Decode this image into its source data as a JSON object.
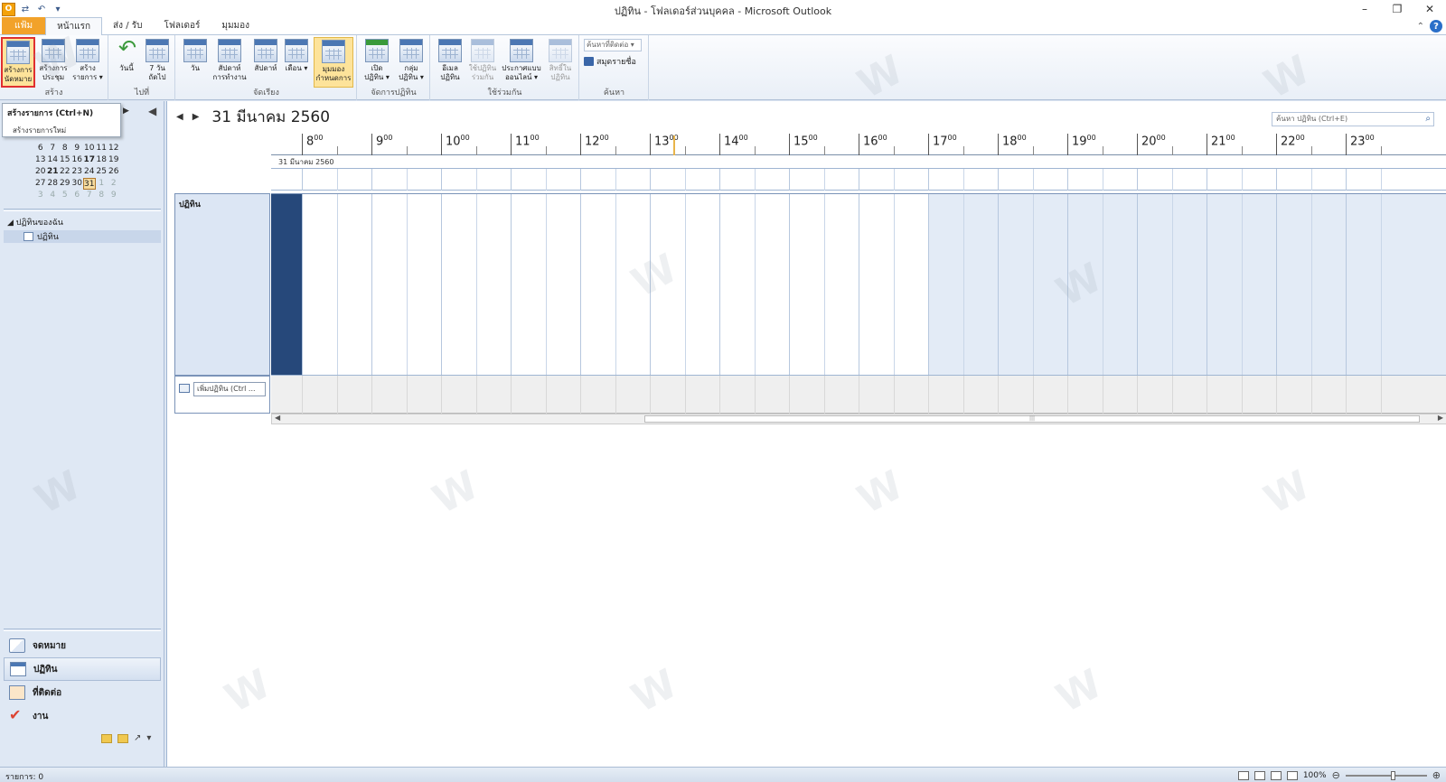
{
  "window": {
    "title": "ปฏิทิน - โฟลเดอร์ส่วนบุคคล - Microsoft Outlook",
    "controls": [
      "–",
      "❐",
      "✕"
    ]
  },
  "tabs": {
    "file": "แฟ้ม",
    "home": "หน้าแรก",
    "send_receive": "ส่ง / รับ",
    "folder": "โฟลเดอร์",
    "view": "มุมมอง"
  },
  "ribbon": {
    "groups": {
      "new": "สร้าง",
      "goto": "ไปที่",
      "arrange": "จัดเรียง",
      "manage": "จัดการปฏิทิน",
      "share": "ใช้ร่วมกัน",
      "find": "ค้นหา"
    },
    "buttons": {
      "new_appointment": "สร้างการ นัดหมาย",
      "new_meeting": "สร้างการ ประชุม",
      "new_items": "สร้าง รายการ ▾",
      "today": "วันนี้",
      "next7": "7 วัน ถัดไป",
      "day": "วัน",
      "work_week": "สัปดาห์ การทำงาน",
      "week": "สัปดาห์",
      "month": "เดือน ▾",
      "schedule_view": "มุมมอง กำหนดการ",
      "open_calendar": "เปิด ปฏิทิน ▾",
      "calendar_groups": "กลุ่ม ปฏิทิน ▾",
      "email_calendar": "อีเมล ปฏิทิน",
      "share_calendar": "ใช้ปฏิทิน ร่วมกัน",
      "publish_online": "ประกาศแบบ ออนไลน์ ▾",
      "calendar_permissions": "สิทธิ์ใน ปฏิทิน"
    },
    "find": {
      "search_people": "ค้นหาที่ติดต่อ ▾",
      "address_book": "สมุดรายชื่อ"
    }
  },
  "tooltip": {
    "title": "สร้างรายการ (Ctrl+N)",
    "desc": "สร้างรายการใหม่"
  },
  "minical": {
    "weeks": [
      [
        {
          "d": "6"
        },
        {
          "d": "7"
        },
        {
          "d": "8"
        },
        {
          "d": "9"
        },
        {
          "d": "10"
        },
        {
          "d": "11"
        },
        {
          "d": "12"
        }
      ],
      [
        {
          "d": "13"
        },
        {
          "d": "14"
        },
        {
          "d": "15"
        },
        {
          "d": "16"
        },
        {
          "d": "17",
          "bold": true
        },
        {
          "d": "18"
        },
        {
          "d": "19"
        }
      ],
      [
        {
          "d": "20"
        },
        {
          "d": "21",
          "bold": true
        },
        {
          "d": "22"
        },
        {
          "d": "23"
        },
        {
          "d": "24"
        },
        {
          "d": "25"
        },
        {
          "d": "26"
        }
      ],
      [
        {
          "d": "27"
        },
        {
          "d": "28"
        },
        {
          "d": "29"
        },
        {
          "d": "30"
        },
        {
          "d": "31",
          "today": true
        },
        {
          "d": "1",
          "muted": true
        },
        {
          "d": "2",
          "muted": true
        }
      ],
      [
        {
          "d": "3",
          "muted": true
        },
        {
          "d": "4",
          "muted": true
        },
        {
          "d": "5",
          "muted": true
        },
        {
          "d": "6",
          "muted": true
        },
        {
          "d": "7",
          "muted": true
        },
        {
          "d": "8",
          "muted": true
        },
        {
          "d": "9",
          "muted": true
        }
      ]
    ]
  },
  "folders": {
    "header": "◢ ปฏิทินของฉัน",
    "item": "ปฏิทิน"
  },
  "modules": [
    {
      "label": "จดหมาย",
      "icon": "mail-icon"
    },
    {
      "label": "ปฏิทิน",
      "icon": "calendar-icon",
      "active": true
    },
    {
      "label": "ที่ติดต่อ",
      "icon": "contacts-icon"
    },
    {
      "label": "งาน",
      "icon": "tasks-icon"
    }
  ],
  "calendar": {
    "date_title": "31 มีนาคม 2560",
    "date_row": "31 มีนาคม 2560",
    "search_placeholder": "ค้นหา ปฏิทิน (Ctrl+E)",
    "calendar_name": "ปฏิทิน",
    "add_calendar_placeholder": "เพิ่มปฏิทิน (Ctrl ...",
    "hours": [
      "8",
      "9",
      "10",
      "11",
      "12",
      "13",
      "14",
      "15",
      "16",
      "17",
      "18",
      "19",
      "20",
      "21",
      "22",
      "23"
    ],
    "minutes_suffix": "00"
  },
  "status": {
    "items": "รายการ: 0",
    "zoom": "100%"
  }
}
